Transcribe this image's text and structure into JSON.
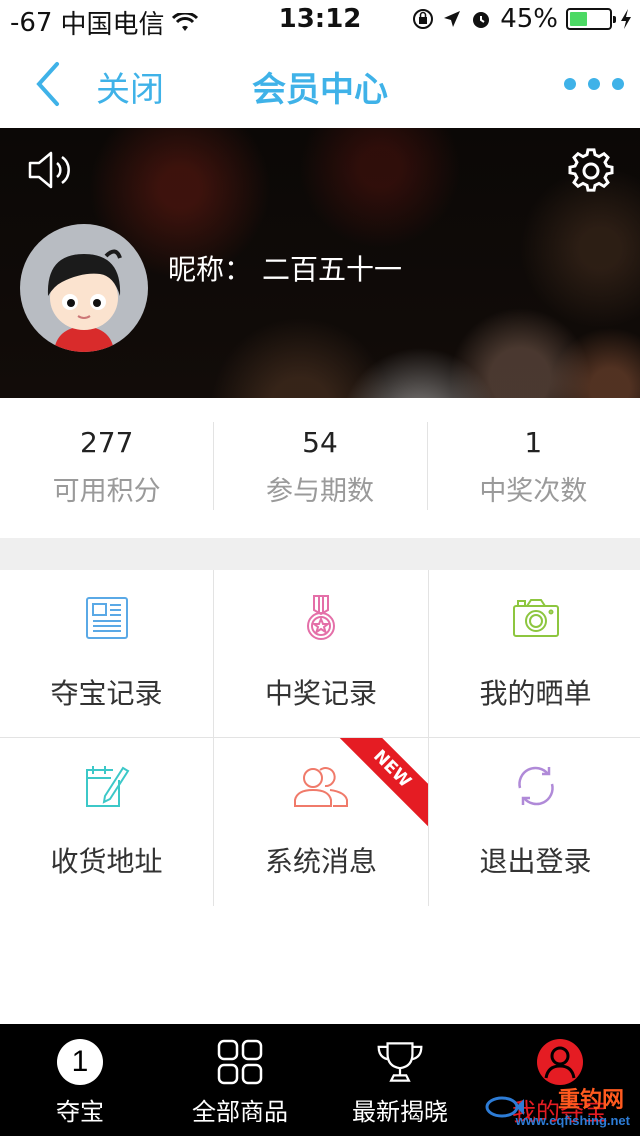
{
  "status_bar": {
    "signal": "-67",
    "carrier": "中国电信",
    "time": "13:12",
    "battery_percent": "45%",
    "battery_level": 0.45
  },
  "nav": {
    "close_label": "关闭",
    "title": "会员中心"
  },
  "profile": {
    "nickname_label": "昵称：",
    "nickname_value": "二百五十一"
  },
  "stats": [
    {
      "value": "277",
      "label": "可用积分"
    },
    {
      "value": "54",
      "label": "参与期数"
    },
    {
      "value": "1",
      "label": "中奖次数"
    }
  ],
  "grid": [
    {
      "label": "夺宝记录",
      "icon": "document-icon",
      "color": "#5aa9e6"
    },
    {
      "label": "中奖记录",
      "icon": "medal-icon",
      "color": "#e46fa8"
    },
    {
      "label": "我的晒单",
      "icon": "camera-icon",
      "color": "#8dc63f"
    },
    {
      "label": "收货地址",
      "icon": "calendar-edit-icon",
      "color": "#3cc8c8"
    },
    {
      "label": "系统消息",
      "icon": "users-icon",
      "color": "#f07a6a",
      "badge": "NEW"
    },
    {
      "label": "退出登录",
      "icon": "refresh-icon",
      "color": "#b08ad8"
    }
  ],
  "tabs": [
    {
      "label": "夺宝",
      "icon": "number-one-icon",
      "number": "1"
    },
    {
      "label": "全部商品",
      "icon": "grid-icon"
    },
    {
      "label": "最新揭晓",
      "icon": "trophy-icon"
    },
    {
      "label": "我的夺宝",
      "icon": "user-circle-icon",
      "active": true
    }
  ],
  "watermark": {
    "text": "重钓网",
    "url": "www.cqfishing.net"
  },
  "colors": {
    "accent": "#3fb2e8",
    "active_tab": "#e51c23"
  }
}
